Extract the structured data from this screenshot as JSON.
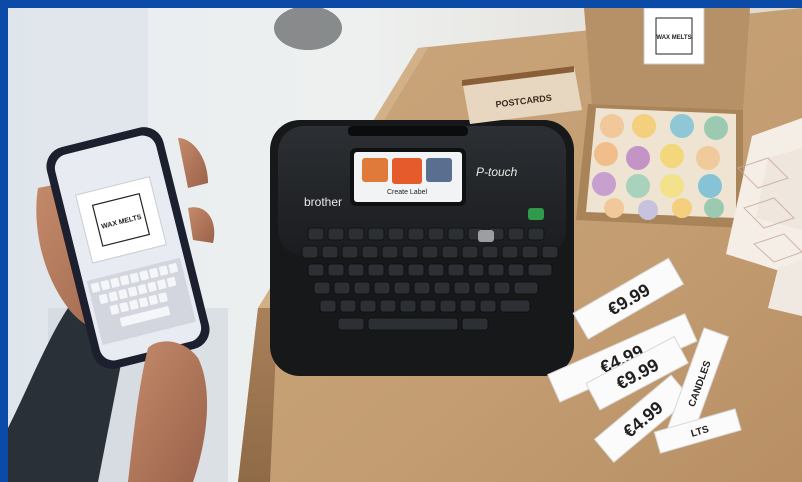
{
  "scene": {
    "description_colors": {
      "brand_blue": "#0b4aa6",
      "labeler_body": "#222426",
      "table_wood": "#c8a57c"
    }
  },
  "phone": {
    "label_line1": "WAX MELTS"
  },
  "labeler": {
    "brand": "brother",
    "model_script": "P-touch",
    "screen_caption": "Create Label"
  },
  "box": {
    "lid_line1": "WAX MELTS",
    "postcards": "POSTCARDS"
  },
  "price_tags": [
    {
      "text": "€9.99"
    },
    {
      "text": "€4.99"
    },
    {
      "text": "€9.99"
    },
    {
      "text": "€4.99"
    }
  ],
  "side_tags": [
    {
      "text": "CANDLES"
    },
    {
      "text": "LTS"
    }
  ]
}
